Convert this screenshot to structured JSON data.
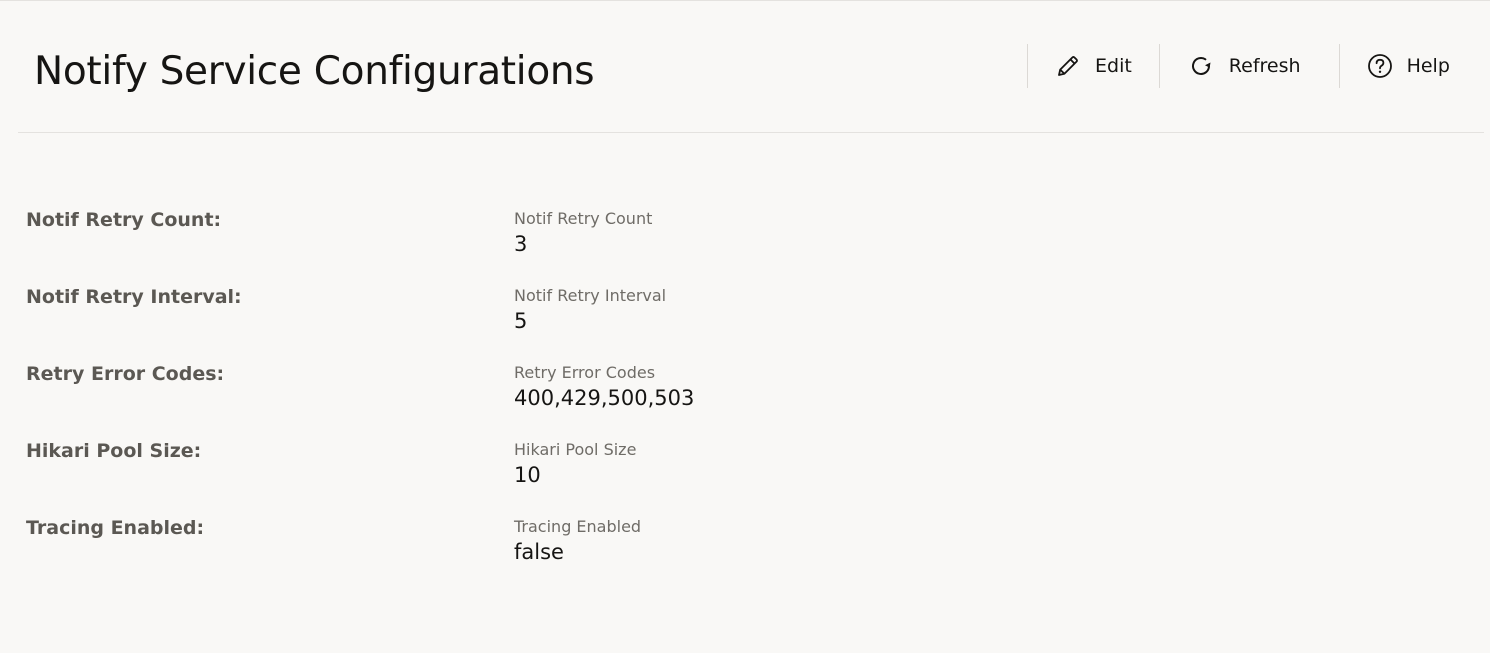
{
  "header": {
    "title": "Notify Service Configurations"
  },
  "toolbar": {
    "edit_label": "Edit",
    "refresh_label": "Refresh",
    "help_label": "Help",
    "icons": {
      "edit": "pencil-icon",
      "refresh": "refresh-icon",
      "help": "help-circle-icon"
    }
  },
  "form": {
    "rows": [
      {
        "label": "Notif Retry Count:",
        "field_label": "Notif Retry Count",
        "value": "3"
      },
      {
        "label": "Notif Retry Interval:",
        "field_label": "Notif Retry Interval",
        "value": "5"
      },
      {
        "label": "Retry Error Codes:",
        "field_label": "Retry Error Codes",
        "value": "400,429,500,503"
      },
      {
        "label": "Hikari Pool Size:",
        "field_label": "Hikari Pool Size",
        "value": "10"
      },
      {
        "label": "Tracing Enabled:",
        "field_label": "Tracing Enabled",
        "value": "false"
      }
    ]
  },
  "colors": {
    "background": "#f9f8f6",
    "text": "#161513",
    "label": "#5b5853",
    "divider": "#e4e2df"
  }
}
